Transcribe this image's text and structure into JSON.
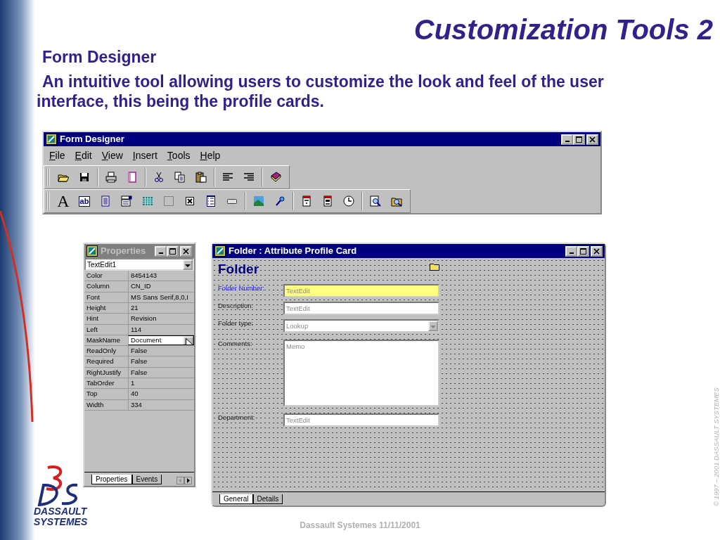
{
  "slide": {
    "title": "Customization Tools 2",
    "subtitle": "Form Designer",
    "description": "An intuitive tool allowing users to customize the look and feel of the user interface, this being the profile cards.",
    "footer": "Dassault Systemes 11/11/2001",
    "copyright": "© 1997 – 2001 DASSAULT SYSTEMES",
    "logo_lines": [
      "DASSAULT",
      "SYSTEMES"
    ]
  },
  "form_designer": {
    "title": "Form Designer",
    "active": true,
    "menu": [
      "File",
      "Edit",
      "View",
      "Insert",
      "Tools",
      "Help"
    ],
    "toolbars": [
      {
        "items": [
          {
            "kind": "open"
          },
          {
            "kind": "save"
          },
          {
            "kind": "separator"
          },
          {
            "kind": "print"
          },
          {
            "kind": "page"
          },
          {
            "kind": "separator"
          },
          {
            "kind": "cut"
          },
          {
            "kind": "copy"
          },
          {
            "kind": "paste"
          },
          {
            "kind": "separator"
          },
          {
            "kind": "align-left"
          },
          {
            "kind": "align-right"
          },
          {
            "kind": "separator"
          },
          {
            "kind": "help-book"
          }
        ]
      },
      {
        "items": [
          {
            "kind": "glyph",
            "text": "A"
          },
          {
            "kind": "boxed-glyph",
            "text": "ab"
          },
          {
            "kind": "list"
          },
          {
            "kind": "combo"
          },
          {
            "kind": "grid"
          },
          {
            "kind": "panel"
          },
          {
            "kind": "checkbox"
          },
          {
            "kind": "listbox"
          },
          {
            "kind": "button"
          },
          {
            "kind": "separator"
          },
          {
            "kind": "image"
          },
          {
            "kind": "wand"
          },
          {
            "kind": "separator"
          },
          {
            "kind": "calendar"
          },
          {
            "kind": "calendar-time"
          },
          {
            "kind": "clock"
          },
          {
            "kind": "separator"
          },
          {
            "kind": "zoom"
          },
          {
            "kind": "zoom-folder"
          }
        ]
      }
    ]
  },
  "properties": {
    "title": "Properties",
    "active": false,
    "object": "TextEdit1",
    "rows": [
      {
        "name": "Color",
        "value": "8454143",
        "editing": false
      },
      {
        "name": "Column",
        "value": "CN_ID",
        "editing": false
      },
      {
        "name": "Font",
        "value": "MS Sans Serif,8,0,I",
        "editing": false
      },
      {
        "name": "Height",
        "value": "21",
        "editing": false
      },
      {
        "name": "Hint",
        "value": "Revision",
        "editing": false
      },
      {
        "name": "Left",
        "value": "114",
        "editing": false
      },
      {
        "name": "MaskName",
        "value": "Document",
        "editing": true
      },
      {
        "name": "ReadOnly",
        "value": "False",
        "editing": false
      },
      {
        "name": "Required",
        "value": "False",
        "editing": false
      },
      {
        "name": "RightJustify",
        "value": "False",
        "editing": false
      },
      {
        "name": "TabOrder",
        "value": "1",
        "editing": false
      },
      {
        "name": "Top",
        "value": "40",
        "editing": false
      },
      {
        "name": "Width",
        "value": "334",
        "editing": false
      }
    ],
    "tabs": [
      {
        "label": "Properties",
        "selected": true
      },
      {
        "label": "Events",
        "selected": false
      }
    ]
  },
  "profile_card": {
    "title": "Folder : Attribute Profile Card",
    "active": true,
    "heading": "Folder",
    "fields": [
      {
        "label": "Folder Number:",
        "kind": "text",
        "placeholder": "TextEdit",
        "selected": true
      },
      {
        "label": "Description:",
        "kind": "text",
        "placeholder": "TextEdit",
        "selected": false
      },
      {
        "label": "Folder type:",
        "kind": "combo",
        "placeholder": "Lookup",
        "selected": false
      },
      {
        "label": "Comments:",
        "kind": "memo",
        "placeholder": "Memo",
        "selected": false
      },
      {
        "label": "Department:",
        "kind": "text",
        "placeholder": "TextEdit",
        "selected": false
      }
    ],
    "tabs": [
      {
        "label": "General",
        "selected": true
      },
      {
        "label": "Details",
        "selected": false
      }
    ]
  }
}
